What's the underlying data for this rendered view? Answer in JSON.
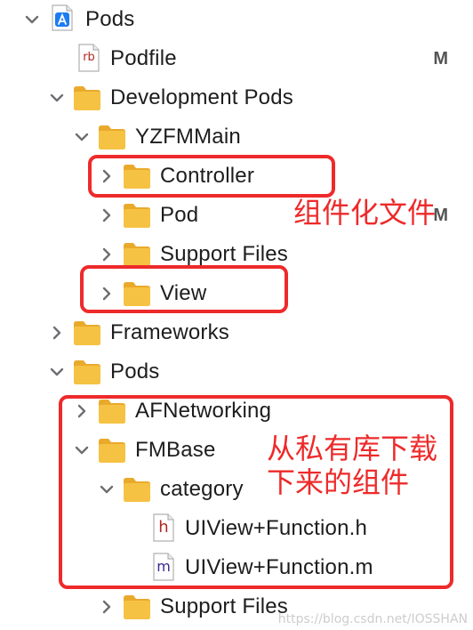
{
  "navigator": {
    "rows": [
      {
        "label": "Pods",
        "icon": "xcode-project-icon",
        "expanded": true
      },
      {
        "label": "Podfile",
        "icon": "ruby-file-icon",
        "file_badge": "rb",
        "status": "M"
      },
      {
        "label": "Development Pods",
        "icon": "folder-icon",
        "expanded": true
      },
      {
        "label": "YZFMMain",
        "icon": "folder-icon",
        "expanded": true
      },
      {
        "label": "Controller",
        "icon": "folder-icon",
        "expanded": false
      },
      {
        "label": "Pod",
        "icon": "folder-icon",
        "expanded": false,
        "status": "M"
      },
      {
        "label": "Support Files",
        "icon": "folder-icon",
        "expanded": false
      },
      {
        "label": "View",
        "icon": "folder-icon",
        "expanded": false
      },
      {
        "label": "Frameworks",
        "icon": "folder-icon",
        "expanded": false
      },
      {
        "label": "Pods",
        "icon": "folder-icon",
        "expanded": true
      },
      {
        "label": "AFNetworking",
        "icon": "folder-icon",
        "expanded": false
      },
      {
        "label": "FMBase",
        "icon": "folder-icon",
        "expanded": true
      },
      {
        "label": "category",
        "icon": "folder-icon",
        "expanded": true
      },
      {
        "label": "UIView+Function.h",
        "icon": "header-file-icon",
        "file_badge": "h"
      },
      {
        "label": "UIView+Function.m",
        "icon": "objc-file-icon",
        "file_badge": "m"
      },
      {
        "label": "Support Files",
        "icon": "folder-icon",
        "expanded": false
      }
    ]
  },
  "annotations": {
    "componentized_files": "组件化文件",
    "downloaded_line1": "从私有库下载",
    "downloaded_line2": "下来的组件"
  },
  "watermark": "https://blog.csdn.net/IOSSHAN",
  "colors": {
    "annotation_red": "#ee2a2a",
    "folder_yellow": "#f6c243",
    "text": "#1d1d1f"
  }
}
